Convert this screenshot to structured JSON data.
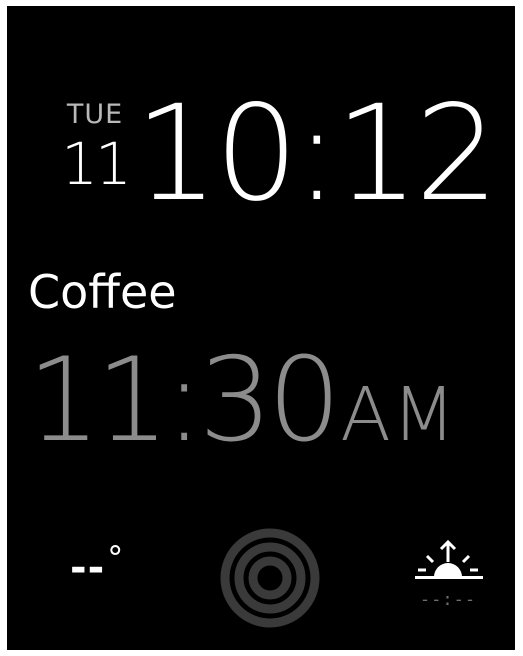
{
  "date": {
    "weekday": "TUE",
    "day": "11"
  },
  "clock": {
    "time": "10:12"
  },
  "event": {
    "title": "Coffee",
    "time": "11:30",
    "ampm": "AM"
  },
  "weather": {
    "temperature": "--",
    "degree_symbol": "°"
  },
  "activity": {
    "icon": "activity-rings-icon",
    "ring_color": "#3a3a3a"
  },
  "sunrise": {
    "icon": "sunrise-icon",
    "time": "--:--"
  },
  "colors": {
    "background": "#000000",
    "primary_text": "#ffffff",
    "secondary_text": "#8c8c8c"
  }
}
